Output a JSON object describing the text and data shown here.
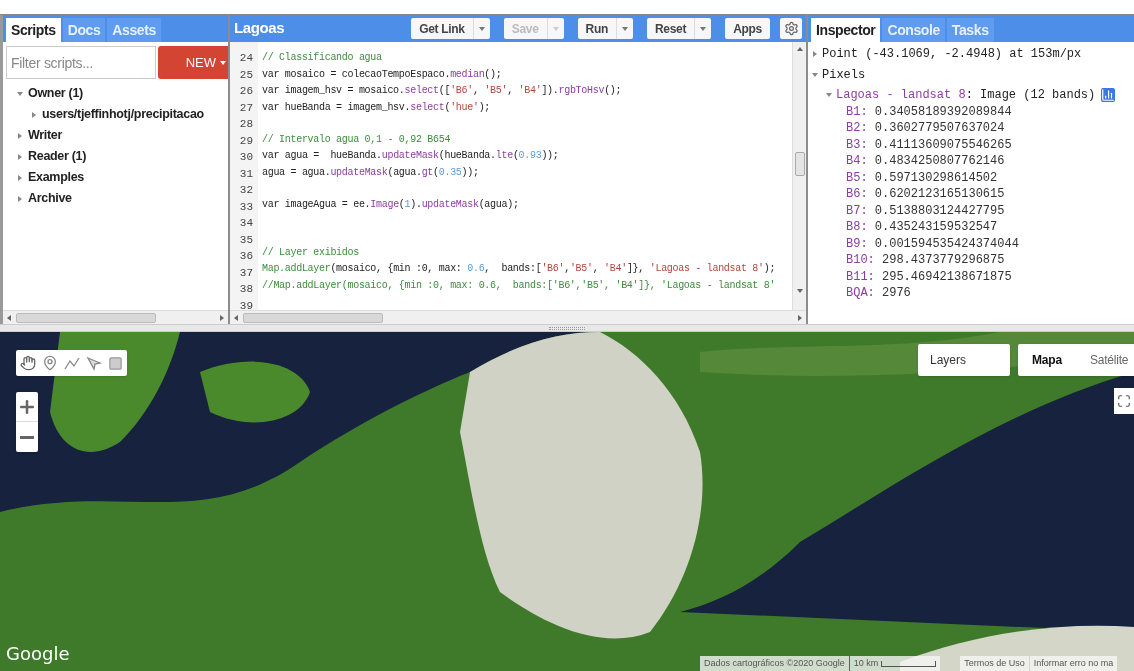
{
  "left_panel": {
    "tabs": [
      {
        "label": "Scripts",
        "selected": true
      },
      {
        "label": "Docs",
        "selected": false
      },
      {
        "label": "Assets",
        "selected": false
      }
    ],
    "filter": {
      "placeholder": "Filter scripts..."
    },
    "new_button": {
      "label": "NEW"
    },
    "tree": [
      {
        "label": "Owner (1)",
        "expanded": true,
        "children": [
          {
            "label": "users/tjeffinhotj/precipitacao",
            "expanded": false
          }
        ]
      },
      {
        "label": "Writer",
        "expanded": false
      },
      {
        "label": "Reader (1)",
        "expanded": false
      },
      {
        "label": "Examples",
        "expanded": false
      },
      {
        "label": "Archive",
        "expanded": false
      }
    ]
  },
  "editor": {
    "title": "Lagoas",
    "buttons": [
      {
        "label": "Get Link",
        "disabled": false,
        "dropdown": true
      },
      {
        "label": "Save",
        "disabled": true,
        "dropdown": true
      },
      {
        "label": "Run",
        "disabled": false,
        "dropdown": true
      },
      {
        "label": "Reset",
        "disabled": false,
        "dropdown": true
      },
      {
        "label": "Apps",
        "disabled": false,
        "dropdown": false
      }
    ],
    "lines": [
      {
        "number": "24",
        "tokens": [
          {
            "kind": "comment",
            "text": "// Classificando agua"
          }
        ]
      },
      {
        "number": "25",
        "tokens": [
          {
            "kind": "plain",
            "text": "var mosaico = colecaoTempoEspaco."
          },
          {
            "kind": "method",
            "text": "median"
          },
          {
            "kind": "plain",
            "text": "();"
          }
        ]
      },
      {
        "number": "26",
        "tokens": [
          {
            "kind": "plain",
            "text": "var imagem_hsv = mosaico."
          },
          {
            "kind": "method",
            "text": "select"
          },
          {
            "kind": "plain",
            "text": "(["
          },
          {
            "kind": "string",
            "text": "'B6'"
          },
          {
            "kind": "plain",
            "text": ", "
          },
          {
            "kind": "string",
            "text": "'B5'"
          },
          {
            "kind": "plain",
            "text": ", "
          },
          {
            "kind": "string",
            "text": "'B4'"
          },
          {
            "kind": "plain",
            "text": "])."
          },
          {
            "kind": "method",
            "text": "rgbToHsv"
          },
          {
            "kind": "plain",
            "text": "();"
          }
        ]
      },
      {
        "number": "27",
        "tokens": [
          {
            "kind": "plain",
            "text": "var hueBanda = imagem_hsv."
          },
          {
            "kind": "method",
            "text": "select"
          },
          {
            "kind": "plain",
            "text": "("
          },
          {
            "kind": "string",
            "text": "'hue'"
          },
          {
            "kind": "plain",
            "text": ");"
          }
        ]
      },
      {
        "number": "28"
      },
      {
        "number": "29",
        "tokens": [
          {
            "kind": "comment",
            "text": "// Intervalo agua 0,1 - 0,92 B654"
          }
        ]
      },
      {
        "number": "30",
        "tokens": [
          {
            "kind": "plain",
            "text": "var agua =  hueBanda."
          },
          {
            "kind": "method",
            "text": "updateMask"
          },
          {
            "kind": "plain",
            "text": "(hueBanda."
          },
          {
            "kind": "method",
            "text": "lte"
          },
          {
            "kind": "plain",
            "text": "("
          },
          {
            "kind": "number",
            "text": "0.93"
          },
          {
            "kind": "plain",
            "text": "));"
          }
        ]
      },
      {
        "number": "31",
        "tokens": [
          {
            "kind": "plain",
            "text": "agua = agua."
          },
          {
            "kind": "method",
            "text": "updateMask"
          },
          {
            "kind": "plain",
            "text": "(agua."
          },
          {
            "kind": "method",
            "text": "gt"
          },
          {
            "kind": "plain",
            "text": "("
          },
          {
            "kind": "number",
            "text": "0.35"
          },
          {
            "kind": "plain",
            "text": "));"
          }
        ]
      },
      {
        "number": "32"
      },
      {
        "number": "33",
        "tokens": [
          {
            "kind": "plain",
            "text": "var imageAgua = ee."
          },
          {
            "kind": "method",
            "text": "Image"
          },
          {
            "kind": "plain",
            "text": "("
          },
          {
            "kind": "number",
            "text": "1"
          },
          {
            "kind": "plain",
            "text": ")."
          },
          {
            "kind": "method",
            "text": "updateMask"
          },
          {
            "kind": "plain",
            "text": "(agua);"
          }
        ]
      },
      {
        "number": "34"
      },
      {
        "number": "35"
      },
      {
        "number": "36",
        "tokens": [
          {
            "kind": "comment",
            "text": "// Layer exibidos"
          }
        ]
      },
      {
        "number": "37",
        "tokens": [
          {
            "kind": "global",
            "text": "Map.addLayer"
          },
          {
            "kind": "plain",
            "text": "(mosaico, {min :0, max: "
          },
          {
            "kind": "number",
            "text": "0.6"
          },
          {
            "kind": "plain",
            "text": ",  bands:["
          },
          {
            "kind": "string",
            "text": "'B6'"
          },
          {
            "kind": "plain",
            "text": ","
          },
          {
            "kind": "string",
            "text": "'B5'"
          },
          {
            "kind": "plain",
            "text": ", "
          },
          {
            "kind": "string",
            "text": "'B4'"
          },
          {
            "kind": "plain",
            "text": "]}, "
          },
          {
            "kind": "string",
            "text": "'Lagoas - landsat 8'"
          },
          {
            "kind": "plain",
            "text": ");"
          }
        ]
      },
      {
        "number": "38",
        "tokens": [
          {
            "kind": "comment",
            "text": "//Map.addLayer(mosaico, {min :0, max: 0.6,  bands:['B6','B5', 'B4']}, 'Lagoas - landsat 8'"
          }
        ]
      },
      {
        "number": "39"
      }
    ]
  },
  "inspector": {
    "tabs": [
      {
        "label": "Inspector",
        "selected": true
      },
      {
        "label": "Console",
        "selected": false
      },
      {
        "label": "Tasks",
        "selected": false
      }
    ],
    "point": {
      "text": "Point (-43.1069, -2.4948) at 153m/px",
      "expanded": false
    },
    "pixels": {
      "label": "Pixels",
      "expanded": true
    },
    "layer": {
      "name": "Lagoas - landsat 8",
      "type": ": Image (12 bands)",
      "expanded": true
    },
    "bands": [
      {
        "key": "B1:",
        "value": " 0.34058189392089844"
      },
      {
        "key": "B2:",
        "value": " 0.3602779507637024"
      },
      {
        "key": "B3:",
        "value": " 0.41113609075546265"
      },
      {
        "key": "B4:",
        "value": " 0.4834250807762146"
      },
      {
        "key": "B5:",
        "value": " 0.597130298614502"
      },
      {
        "key": "B6:",
        "value": " 0.6202123165130615"
      },
      {
        "key": "B7:",
        "value": " 0.5138803124427795"
      },
      {
        "key": "B8:",
        "value": " 0.435243159532547"
      },
      {
        "key": "B9:",
        "value": " 0.001594535424374044"
      },
      {
        "key": "B10:",
        "value": " 298.4373779296875"
      },
      {
        "key": "B11:",
        "value": " 295.46942138671875"
      },
      {
        "key": "BQA:",
        "value": " 2976"
      }
    ]
  },
  "map": {
    "layers_button": "Layers",
    "map_types": [
      {
        "label": "Mapa",
        "selected": true
      },
      {
        "label": "Satélite",
        "selected": false
      }
    ],
    "logo": "Google",
    "attribution": "Dados cartográficos ©2020 Google",
    "scale": "10 km",
    "terms": "Termos de Uso",
    "report": "Informar erro no ma"
  }
}
